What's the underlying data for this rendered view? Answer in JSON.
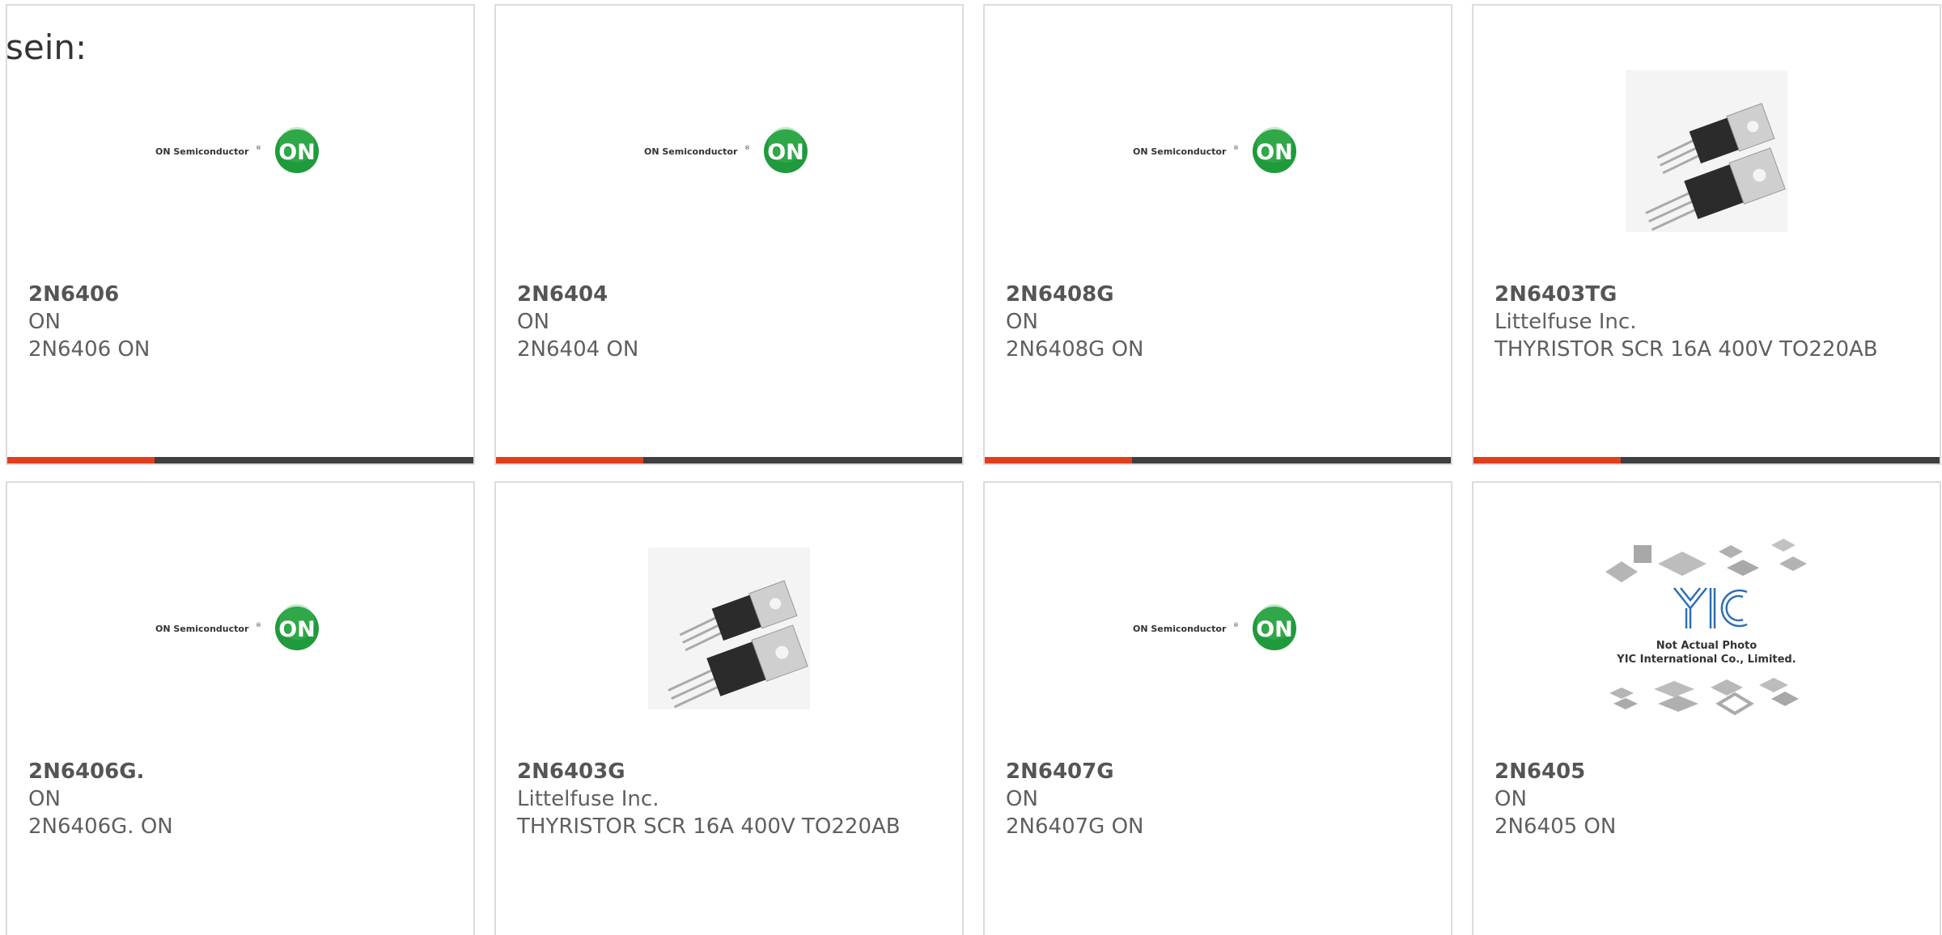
{
  "intro_text": "sein:",
  "colors": {
    "accent": "#e23d1c",
    "bar": "#3f3f3f",
    "on_logo_green": "#1f9a3c",
    "border": "#dcdcdc"
  },
  "logo": {
    "on_text": "ON Semiconductor",
    "on_badge": "ON"
  },
  "yic": {
    "not_actual": "Not Actual Photo",
    "company": "YIC International Co., Limited."
  },
  "products": [
    {
      "part": "2N6406",
      "manufacturer": "ON",
      "description": "2N6406 ON",
      "image": "on-semiconductor-logo"
    },
    {
      "part": "2N6404",
      "manufacturer": "ON",
      "description": "2N6404 ON",
      "image": "on-semiconductor-logo"
    },
    {
      "part": "2N6408G",
      "manufacturer": "ON",
      "description": "2N6408G ON",
      "image": "on-semiconductor-logo"
    },
    {
      "part": "2N6403TG",
      "manufacturer": "Littelfuse Inc.",
      "description": "THYRISTOR SCR 16A 400V TO220AB",
      "image": "to220-package-photo"
    },
    {
      "part": "2N6406G.",
      "manufacturer": "ON",
      "description": "2N6406G. ON",
      "image": "on-semiconductor-logo"
    },
    {
      "part": "2N6403G",
      "manufacturer": "Littelfuse Inc.",
      "description": "THYRISTOR SCR 16A 400V TO220AB",
      "image": "to220-package-photo"
    },
    {
      "part": "2N6407G",
      "manufacturer": "ON",
      "description": "2N6407G ON",
      "image": "on-semiconductor-logo"
    },
    {
      "part": "2N6405",
      "manufacturer": "ON",
      "description": "2N6405 ON",
      "image": "yic-not-actual-photo"
    }
  ]
}
